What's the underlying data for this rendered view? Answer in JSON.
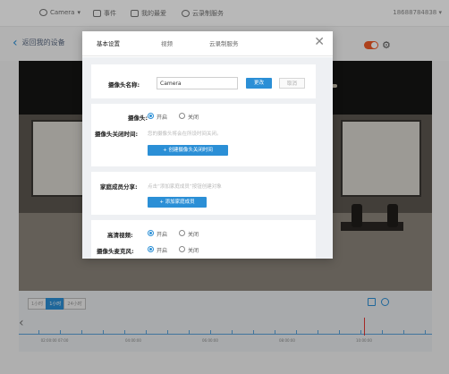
{
  "topbar": {
    "camera": "Camera",
    "events": "事件",
    "favorites": "我的最爱",
    "cloud": "云录制服务",
    "phone": "18688784838"
  },
  "device": {
    "back_label": "返回我的设备",
    "power_on": true
  },
  "modal": {
    "tabs": [
      "基本设置",
      "视频",
      "云录制服务"
    ],
    "close_icon": "close-icon",
    "camera_name_label": "摄像头名称:",
    "camera_name_value": "Camera",
    "change_button": "更改",
    "cancel_button": "取消",
    "camera_label": "摄像头:",
    "on_label": "开启",
    "off_label": "关闭",
    "close_time_label": "摄像头关闭时间:",
    "close_time_hint": "您的摄像头将会在所设时间关闭。",
    "create_schedule_button": "+ 创建摄像头关闭时间",
    "family_share_label": "家庭成员分享:",
    "family_share_hint": "点击“添加家庭成员”按钮创建对象",
    "add_family_button": "+ 添加家庭成员",
    "hd_video_label": "高清视频:",
    "mic_label": "摄像头麦克风:"
  },
  "timeline": {
    "zoom_options": [
      "1小时",
      "1小时",
      "24小时"
    ],
    "active_zoom": 1,
    "tick_labels": [
      "02:00:00 07:00",
      "04:00:00",
      "06:00:00",
      "08:00:00",
      "10:00:00"
    ]
  },
  "colors": {
    "accent": "#2b8fd6",
    "toggle": "#f05a28"
  }
}
